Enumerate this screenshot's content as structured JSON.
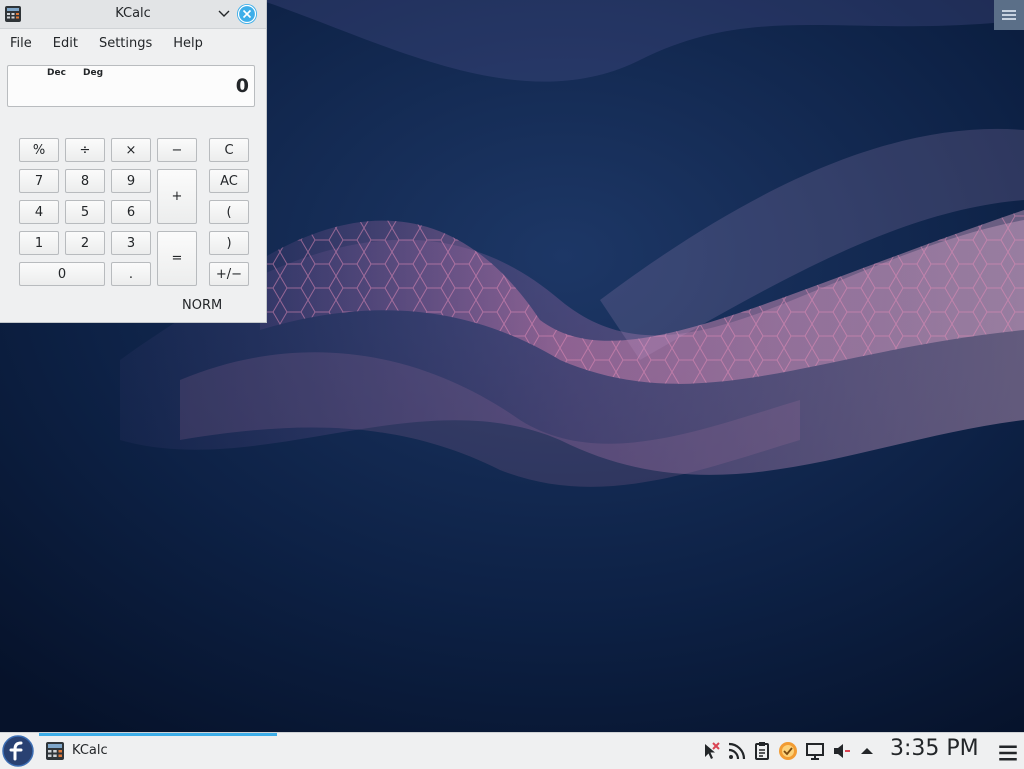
{
  "window": {
    "title": "KCalc",
    "menu": [
      "File",
      "Edit",
      "Settings",
      "Help"
    ]
  },
  "display": {
    "base_mode": "Dec",
    "angle_mode": "Deg",
    "value": "0"
  },
  "buttons": {
    "percent": "%",
    "divide": "÷",
    "multiply": "×",
    "minus": "−",
    "clear": "C",
    "n7": "7",
    "n8": "8",
    "n9": "9",
    "plus": "+",
    "all_clear": "AC",
    "n4": "4",
    "n5": "5",
    "n6": "6",
    "open_paren": "(",
    "n1": "1",
    "n2": "2",
    "n3": "3",
    "equals": "=",
    "close_paren": ")",
    "n0": "0",
    "decimal": ".",
    "sign": "+/−"
  },
  "status": {
    "mode": "NORM"
  },
  "taskbar": {
    "task_label": "KCalc",
    "clock": "3:35 PM"
  },
  "colors": {
    "accent": "#3daee9"
  }
}
